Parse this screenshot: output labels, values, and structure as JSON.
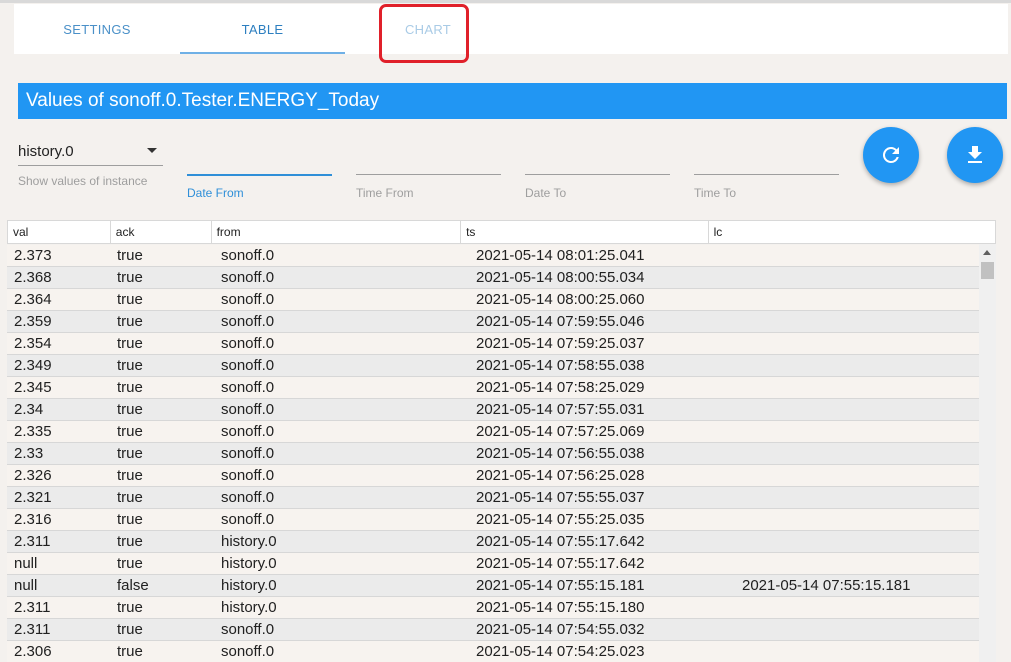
{
  "tabs": [
    {
      "label": "SETTINGS"
    },
    {
      "label": "TABLE"
    },
    {
      "label": "CHART"
    }
  ],
  "title": "Values of sonoff.0.Tester.ENERGY_Today",
  "instance": {
    "value": "history.0",
    "helper": "Show values of instance"
  },
  "filters": {
    "date_from": "Date From",
    "time_from": "Time From",
    "date_to": "Date To",
    "time_to": "Time To"
  },
  "buttons": {
    "refresh_icon": "refresh-icon",
    "download_icon": "download-icon"
  },
  "colors": {
    "accent": "#2196f3",
    "annotation": "#e0202a"
  },
  "table": {
    "columns": [
      "val",
      "ack",
      "from",
      "ts",
      "lc"
    ],
    "rows": [
      [
        "2.373",
        "true",
        "sonoff.0",
        "2021-05-14 08:01:25.041",
        ""
      ],
      [
        "2.368",
        "true",
        "sonoff.0",
        "2021-05-14 08:00:55.034",
        ""
      ],
      [
        "2.364",
        "true",
        "sonoff.0",
        "2021-05-14 08:00:25.060",
        ""
      ],
      [
        "2.359",
        "true",
        "sonoff.0",
        "2021-05-14 07:59:55.046",
        ""
      ],
      [
        "2.354",
        "true",
        "sonoff.0",
        "2021-05-14 07:59:25.037",
        ""
      ],
      [
        "2.349",
        "true",
        "sonoff.0",
        "2021-05-14 07:58:55.038",
        ""
      ],
      [
        "2.345",
        "true",
        "sonoff.0",
        "2021-05-14 07:58:25.029",
        ""
      ],
      [
        "2.34",
        "true",
        "sonoff.0",
        "2021-05-14 07:57:55.031",
        ""
      ],
      [
        "2.335",
        "true",
        "sonoff.0",
        "2021-05-14 07:57:25.069",
        ""
      ],
      [
        "2.33",
        "true",
        "sonoff.0",
        "2021-05-14 07:56:55.038",
        ""
      ],
      [
        "2.326",
        "true",
        "sonoff.0",
        "2021-05-14 07:56:25.028",
        ""
      ],
      [
        "2.321",
        "true",
        "sonoff.0",
        "2021-05-14 07:55:55.037",
        ""
      ],
      [
        "2.316",
        "true",
        "sonoff.0",
        "2021-05-14 07:55:25.035",
        ""
      ],
      [
        "2.311",
        "true",
        "history.0",
        "2021-05-14 07:55:17.642",
        ""
      ],
      [
        "null",
        "true",
        "history.0",
        "2021-05-14 07:55:17.642",
        ""
      ],
      [
        "null",
        "false",
        "history.0",
        "2021-05-14 07:55:15.181",
        "2021-05-14 07:55:15.181"
      ],
      [
        "2.311",
        "true",
        "history.0",
        "2021-05-14 07:55:15.180",
        ""
      ],
      [
        "2.311",
        "true",
        "sonoff.0",
        "2021-05-14 07:54:55.032",
        ""
      ],
      [
        "2.306",
        "true",
        "sonoff.0",
        "2021-05-14 07:54:25.023",
        ""
      ]
    ]
  }
}
